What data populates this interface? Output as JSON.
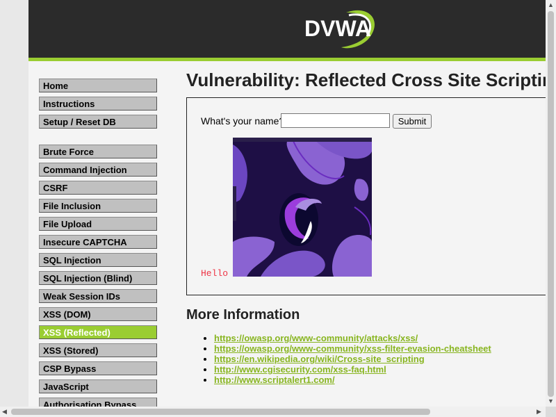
{
  "header": {
    "logo_text": "DVWA"
  },
  "sidebar": {
    "items": [
      {
        "label": "Home"
      },
      {
        "label": "Instructions"
      },
      {
        "label": "Setup / Reset DB"
      },
      {
        "label": "Brute Force"
      },
      {
        "label": "Command Injection"
      },
      {
        "label": "CSRF"
      },
      {
        "label": "File Inclusion"
      },
      {
        "label": "File Upload"
      },
      {
        "label": "Insecure CAPTCHA"
      },
      {
        "label": "SQL Injection"
      },
      {
        "label": "SQL Injection (Blind)"
      },
      {
        "label": "Weak Session IDs"
      },
      {
        "label": "XSS (DOM)"
      },
      {
        "label": "XSS (Reflected)",
        "active": true
      },
      {
        "label": "XSS (Stored)"
      },
      {
        "label": "CSP Bypass"
      },
      {
        "label": "JavaScript"
      },
      {
        "label": "Authorisation Bypass"
      }
    ]
  },
  "main": {
    "title": "Vulnerability: Reflected Cross Site Scripting (XSS)",
    "form": {
      "label": "What's your name?",
      "input_value": "",
      "submit_label": "Submit"
    },
    "output": {
      "hello_text": "Hello"
    },
    "more_info": {
      "heading": "More Information",
      "links": [
        "https://owasp.org/www-community/attacks/xss/",
        "https://owasp.org/www-community/xss-filter-evasion-cheatsheet",
        "https://en.wikipedia.org/wiki/Cross-site_scripting",
        "http://www.cgisecurity.com/xss-faq.html",
        "http://www.scriptalert1.com/"
      ]
    }
  },
  "colors": {
    "accent": "#9acd32",
    "header_bg": "#2b2b2b",
    "link": "#88b520",
    "hello": "#ee3344"
  }
}
